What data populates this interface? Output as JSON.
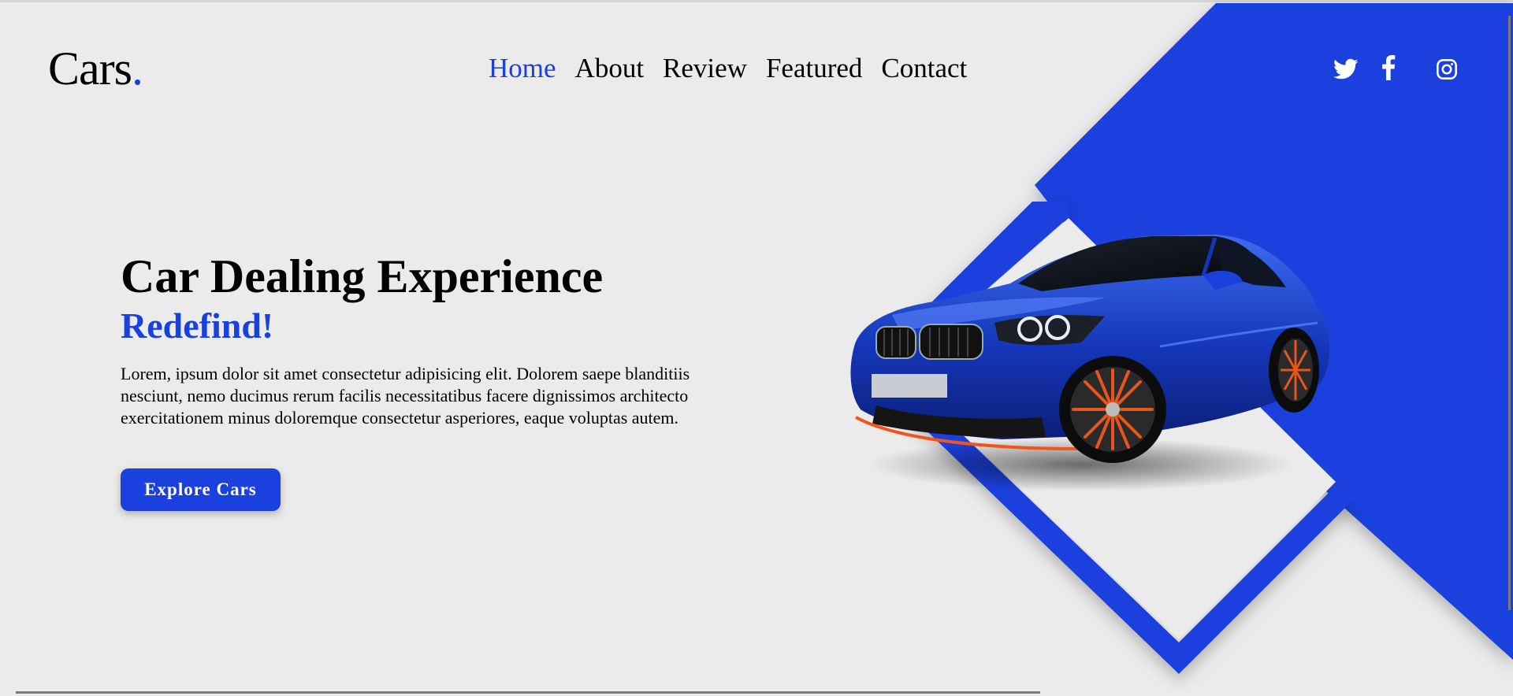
{
  "brand": {
    "name": "Cars",
    "dot": "."
  },
  "nav": {
    "items": [
      "Home",
      "About",
      "Review",
      "Featured",
      "Contact"
    ],
    "active_index": 0
  },
  "social": [
    "twitter-icon",
    "facebook-icon",
    "instagram-icon"
  ],
  "hero": {
    "title": "Car Dealing Experience",
    "subtitle": "Redefind!",
    "text": "Lorem, ipsum dolor sit amet consectetur adipisicing elit. Dolorem saepe blanditiis nesciunt, nemo ducimus rerum facilis necessitatibus facere dignissimos architecto exercitationem minus doloremque consectetur asperiores, eaque voluptas autem.",
    "button_label": "Explore Cars"
  },
  "colors": {
    "accent": "#1a40de",
    "background": "#ebebeb"
  }
}
